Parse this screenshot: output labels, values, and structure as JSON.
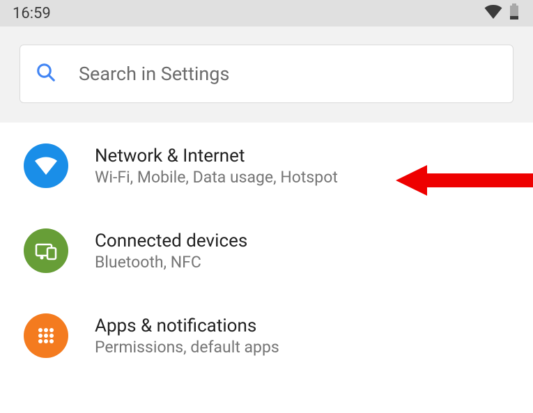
{
  "statusBar": {
    "time": "16:59"
  },
  "search": {
    "placeholder": "Search in Settings"
  },
  "items": [
    {
      "title": "Network & Internet",
      "subtitle": "Wi-Fi, Mobile, Data usage, Hotspot",
      "icon": "wifi",
      "iconColor": "#1a8ee8"
    },
    {
      "title": "Connected devices",
      "subtitle": "Bluetooth, NFC",
      "icon": "devices",
      "iconColor": "#679e37"
    },
    {
      "title": "Apps & notifications",
      "subtitle": "Permissions, default apps",
      "icon": "apps",
      "iconColor": "#f47b1f"
    }
  ]
}
